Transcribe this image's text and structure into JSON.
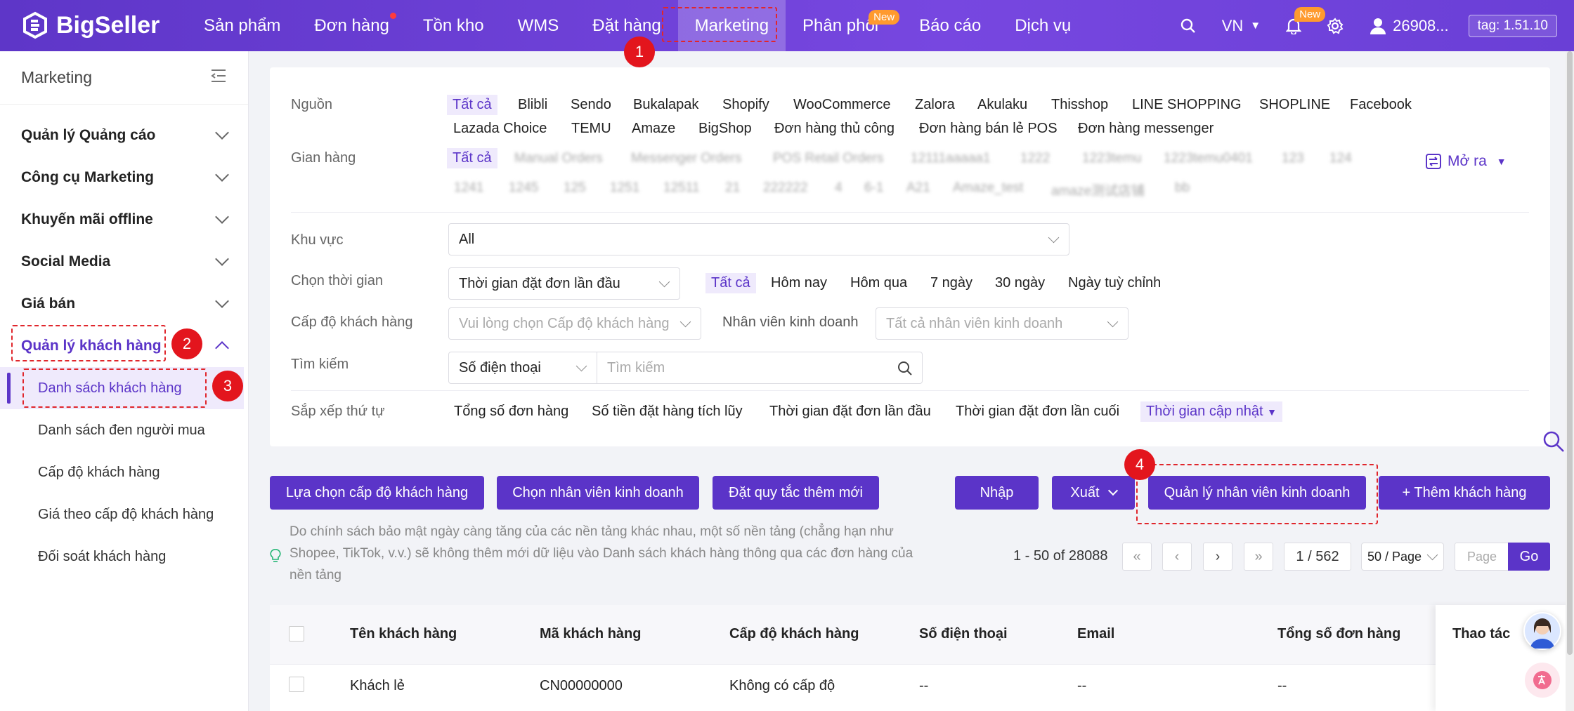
{
  "brand": {
    "name": "BigSeller"
  },
  "nav": [
    "Sản phẩm",
    "Đơn hàng",
    "Tồn kho",
    "WMS",
    "Đặt hàng",
    "Marketing",
    "Phân phối",
    "Báo cáo",
    "Dịch vụ"
  ],
  "nav_badge_new": "New",
  "topright": {
    "lang": "VN",
    "bell_badge": "New",
    "user": "26908...",
    "tag": "tag: 1.51.10"
  },
  "sidebar": {
    "title": "Marketing",
    "groups": [
      "Quản lý Quảng cáo",
      "Công cụ Marketing",
      "Khuyến mãi offline",
      "Social Media",
      "Giá bán",
      "Quản lý khách hàng"
    ],
    "subs": [
      "Danh sách khách hàng",
      "Danh sách đen người mua",
      "Cấp độ khách hàng",
      "Giá theo cấp độ khách hàng",
      "Đối soát khách hàng"
    ]
  },
  "filter": {
    "source_label": "Nguồn",
    "sources_row1": [
      "Tất cả",
      "Blibli",
      "Sendo",
      "Bukalapak",
      "Shopify",
      "WooCommerce",
      "Zalora",
      "Akulaku",
      "Thisshop",
      "LINE SHOPPING",
      "SHOPLINE",
      "Facebook"
    ],
    "sources_row2": [
      "Lazada Choice",
      "TEMU",
      "Amaze",
      "BigShop",
      "Đơn hàng thủ công",
      "Đơn hàng bán lẻ POS",
      "Đơn hàng messenger"
    ],
    "store_label": "Gian hàng",
    "store_all": "Tất cả",
    "stores_row1": [
      "Manual Orders",
      "Messenger Orders",
      "POS Retail Orders",
      "12111aaaaa1",
      "1222",
      "1223temu",
      "1223temu0401",
      "123",
      "124"
    ],
    "stores_row2": [
      "1241",
      "1245",
      "125",
      "1251",
      "12511",
      "21",
      "222222",
      "4",
      "6-1",
      "A21",
      "Amaze_test",
      "amaze测试店铺",
      "bb"
    ],
    "expand": "Mở ra",
    "region_label": "Khu vực",
    "region_value": "All",
    "time_label": "Chọn thời gian",
    "time_select": "Thời gian đặt đơn lần đầu",
    "time_options": [
      "Tất cả",
      "Hôm nay",
      "Hôm qua",
      "7 ngày",
      "30 ngày",
      "Ngày tuỳ chỉnh"
    ],
    "level_label": "Cấp độ khách hàng",
    "level_placeholder": "Vui lòng chọn Cấp độ khách hàng",
    "staff_label": "Nhân viên kinh doanh",
    "staff_placeholder": "Tất cả nhân viên kinh doanh",
    "search_label": "Tìm kiếm",
    "search_type": "Số điện thoại",
    "search_placeholder": "Tìm kiếm",
    "sort_label": "Sắp xếp thứ tự",
    "sort_options": [
      "Tổng số đơn hàng",
      "Số tiền đặt hàng tích lũy",
      "Thời gian đặt đơn lần đầu",
      "Thời gian đặt đơn lần cuối",
      "Thời gian cập nhật"
    ]
  },
  "actions": {
    "choose_level": "Lựa chọn cấp độ khách hàng",
    "choose_staff": "Chọn nhân viên kinh doanh",
    "set_rule": "Đặt quy tắc thêm mới",
    "import": "Nhập",
    "export": "Xuất",
    "manage_staff": "Quản lý nhân viên kinh doanh",
    "add_customer": "+ Thêm khách hàng"
  },
  "note": "Do chính sách bảo mật ngày càng tăng của các nền tảng khác nhau, một số nền tảng (chẳng hạn như Shopee, TikTok, v.v.) sẽ không thêm mới dữ liệu vào Danh sách khách hàng thông qua các đơn hàng của nền tảng",
  "pagination": {
    "range": "1 - 50 of 28088",
    "current": "1 / 562",
    "per_page": "50 / Page",
    "page_placeholder": "Page",
    "go": "Go"
  },
  "table": {
    "headers": [
      "Tên khách hàng",
      "Mã khách hàng",
      "Cấp độ khách hàng",
      "Số điện thoại",
      "Email",
      "Tổng số đơn hàng",
      "Thao tác"
    ],
    "rows": [
      [
        "Khách lẻ",
        "CN00000000",
        "Không có cấp độ",
        "--",
        "--",
        "--"
      ]
    ]
  },
  "steps": [
    "1",
    "2",
    "3",
    "4"
  ],
  "colors": {
    "primary": "#5b34c8",
    "header": "#6a3fd6",
    "highlight": "#e0262c"
  }
}
